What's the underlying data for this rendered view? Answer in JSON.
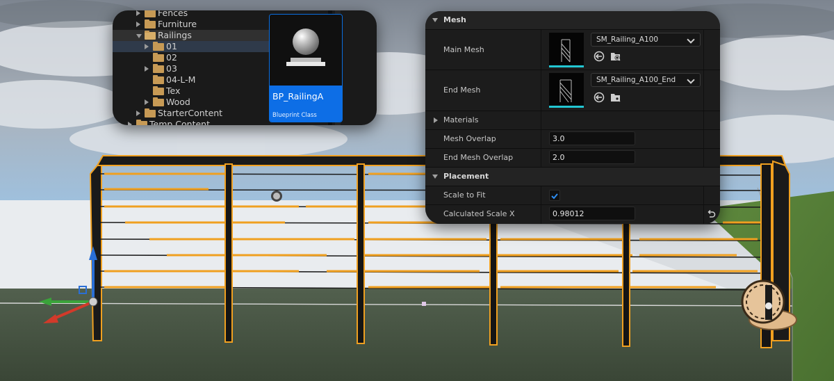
{
  "content_browser": {
    "tree": [
      {
        "label": "Fences",
        "state": "collapsed"
      },
      {
        "label": "Furniture",
        "state": "collapsed"
      },
      {
        "label": "Railings",
        "state": "expanded"
      },
      {
        "label": "01",
        "state": "collapsed"
      },
      {
        "label": "02",
        "state": "leaf"
      },
      {
        "label": "03",
        "state": "collapsed"
      },
      {
        "label": "04-L-M",
        "state": "leaf"
      },
      {
        "label": "Tex",
        "state": "leaf"
      },
      {
        "label": "Wood",
        "state": "collapsed"
      },
      {
        "label": "StarterContent",
        "state": "collapsed"
      },
      {
        "label": "Temp Content",
        "state": "collapsed"
      }
    ],
    "asset": {
      "name": "BP_RailingA",
      "type": "Blueprint Class"
    }
  },
  "details": {
    "mesh_section": "Mesh",
    "main_mesh": {
      "label": "Main Mesh",
      "value": "SM_Railing_A100"
    },
    "end_mesh": {
      "label": "End Mesh",
      "value": "SM_Railing_A100_End"
    },
    "materials": "Materials",
    "mesh_overlap": {
      "label": "Mesh Overlap",
      "value": "3.0"
    },
    "end_mesh_overlap": {
      "label": "End Mesh Overlap",
      "value": "2.0"
    },
    "placement_section": "Placement",
    "scale_to_fit": {
      "label": "Scale to Fit",
      "checked": true
    },
    "calculated_scale_x": {
      "label": "Calculated Scale X",
      "value": "0.98012"
    }
  },
  "colors": {
    "selection_accent": "#0d6ee6",
    "selected_outline": "#f0a020",
    "mesh_thumb_underline": "#22c7d3"
  },
  "icons": [
    "folder-icon",
    "browse-to-asset-icon",
    "use-selected-asset-icon",
    "reset-to-default-icon",
    "checkmark-icon",
    "chevron-down-icon",
    "transform-gizmo",
    "spline-point-handle"
  ]
}
